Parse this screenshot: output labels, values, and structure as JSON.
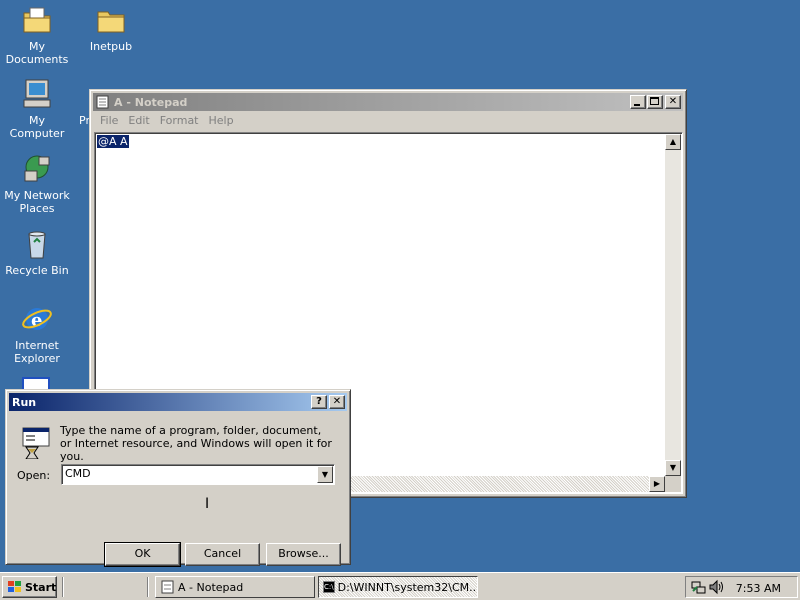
{
  "desktop": {
    "icons": [
      {
        "label": "My Documents"
      },
      {
        "label": "Inetpub"
      },
      {
        "label": "My Computer"
      },
      {
        "label": "Pr"
      },
      {
        "label": "My Network Places"
      },
      {
        "label": "Recycle Bin"
      },
      {
        "label": "Internet Explorer"
      }
    ]
  },
  "notepad": {
    "title": "A - Notepad",
    "menu": [
      "File",
      "Edit",
      "Format",
      "Help"
    ],
    "content_selected": "@A A"
  },
  "run_dialog": {
    "title": "Run",
    "message": "Type the name of a program, folder, document, or Internet resource, and Windows will open it for you.",
    "open_label": "Open:",
    "open_value": "CMD",
    "ok_label": "OK",
    "cancel_label": "Cancel",
    "browse_label": "Browse..."
  },
  "taskbar": {
    "start_label": "Start",
    "tasks": [
      {
        "label": "A - Notepad"
      },
      {
        "label": "D:\\WINNT\\system32\\CM..."
      }
    ],
    "clock": "7:53 AM"
  },
  "colors": {
    "desktop": "#3a6ea5",
    "title_active": "#0a246a",
    "title_inactive": "#808080",
    "selection": "#0a246a"
  }
}
